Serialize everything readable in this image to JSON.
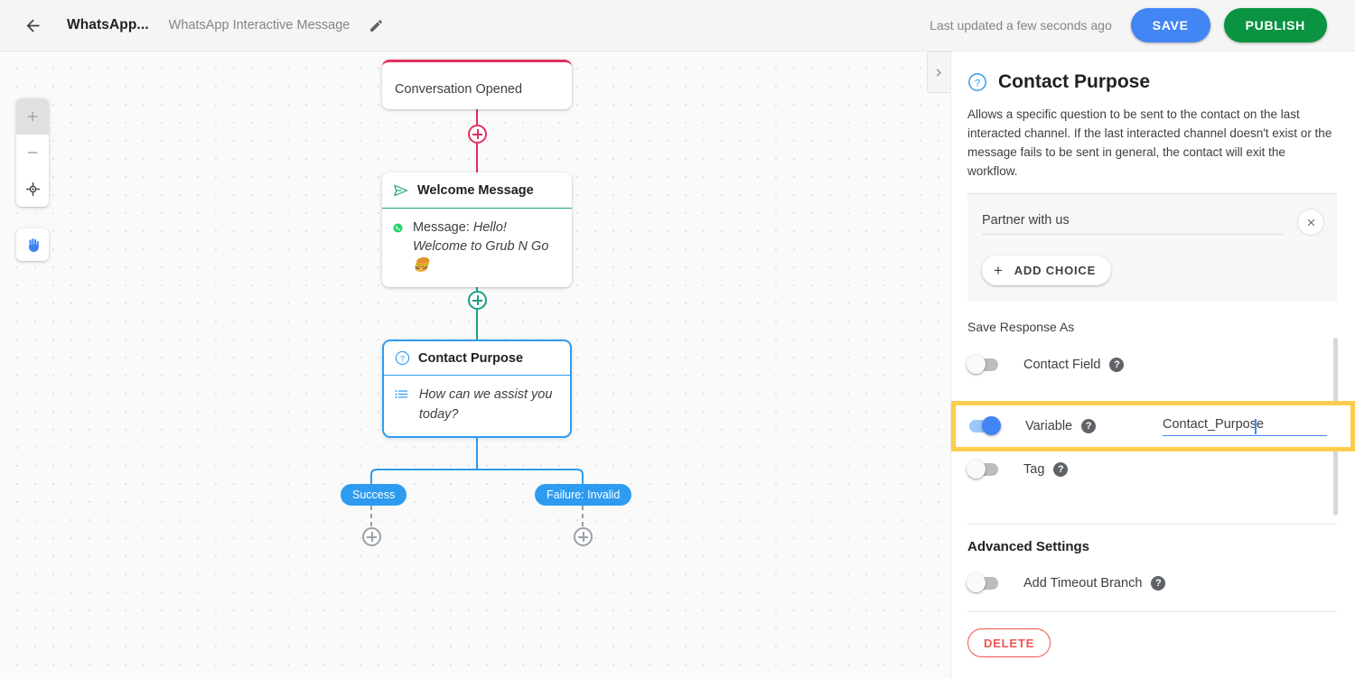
{
  "topbar": {
    "back_icon": "arrow-left-icon",
    "workflow_name": "WhatsApp...",
    "workflow_subtitle": "WhatsApp Interactive Message",
    "edit_icon": "pencil-icon",
    "last_updated": "Last updated a few seconds ago",
    "save_label": "SAVE",
    "publish_label": "PUBLISH",
    "save_color": "#4285f4",
    "publish_color": "#0a9442"
  },
  "canvas": {
    "collapse_icon": "chevron-right-icon",
    "zoom_in_icon": "plus-icon",
    "zoom_out_icon": "minus-icon",
    "fit_icon": "crosshair-icon",
    "pan_icon": "hand-icon",
    "nodes": [
      {
        "id": "trigger",
        "title": "Conversation Opened",
        "accent": "#e3315f",
        "type": "trigger"
      },
      {
        "id": "welcome",
        "title": "Welcome Message",
        "icon": "send-icon",
        "accent": "#1aa083",
        "body_icon": "whatsapp-icon",
        "body_prefix": "Message: ",
        "body_text": "Hello! Welcome to Grub N Go 🍔"
      },
      {
        "id": "contact_purpose",
        "title": "Contact Purpose",
        "icon": "question-circle-icon",
        "accent": "#2d9cf0",
        "body_icon": "list-icon",
        "body_text": "How can we assist you today?",
        "selected": true
      }
    ],
    "branches": [
      {
        "label": "Success",
        "color": "#2d9cf0"
      },
      {
        "label": "Failure: Invalid",
        "color": "#2d9cf0"
      }
    ]
  },
  "panel": {
    "header_icon": "question-circle-icon",
    "title": "Contact Purpose",
    "description": "Allows a specific question to be sent to the contact on the last interacted channel. If the last interacted channel doesn't exist or the message fails to be sent in general, the contact will exit the workflow.",
    "choices": [
      {
        "value": "Partner with us",
        "placeholder": "Choice",
        "remove_icon": "close-icon"
      }
    ],
    "add_choice_label": "ADD CHOICE",
    "save_response_label": "Save Response As",
    "toggles": [
      {
        "id": "contact_field",
        "label": "Contact Field",
        "on": false,
        "help_icon": "help-icon"
      },
      {
        "id": "variable",
        "label": "Variable",
        "on": true,
        "help_icon": "help-icon",
        "value": "Contact_Purpose",
        "placeholder": "Variable Name",
        "highlighted": true
      },
      {
        "id": "tag",
        "label": "Tag",
        "on": false,
        "help_icon": "help-icon"
      }
    ],
    "advanced_settings_label": "Advanced Settings",
    "timeout_toggle": {
      "label": "Add Timeout Branch",
      "on": false,
      "help_icon": "help-icon"
    },
    "delete_label": "DELETE",
    "highlight_color": "#fdcc4c"
  }
}
